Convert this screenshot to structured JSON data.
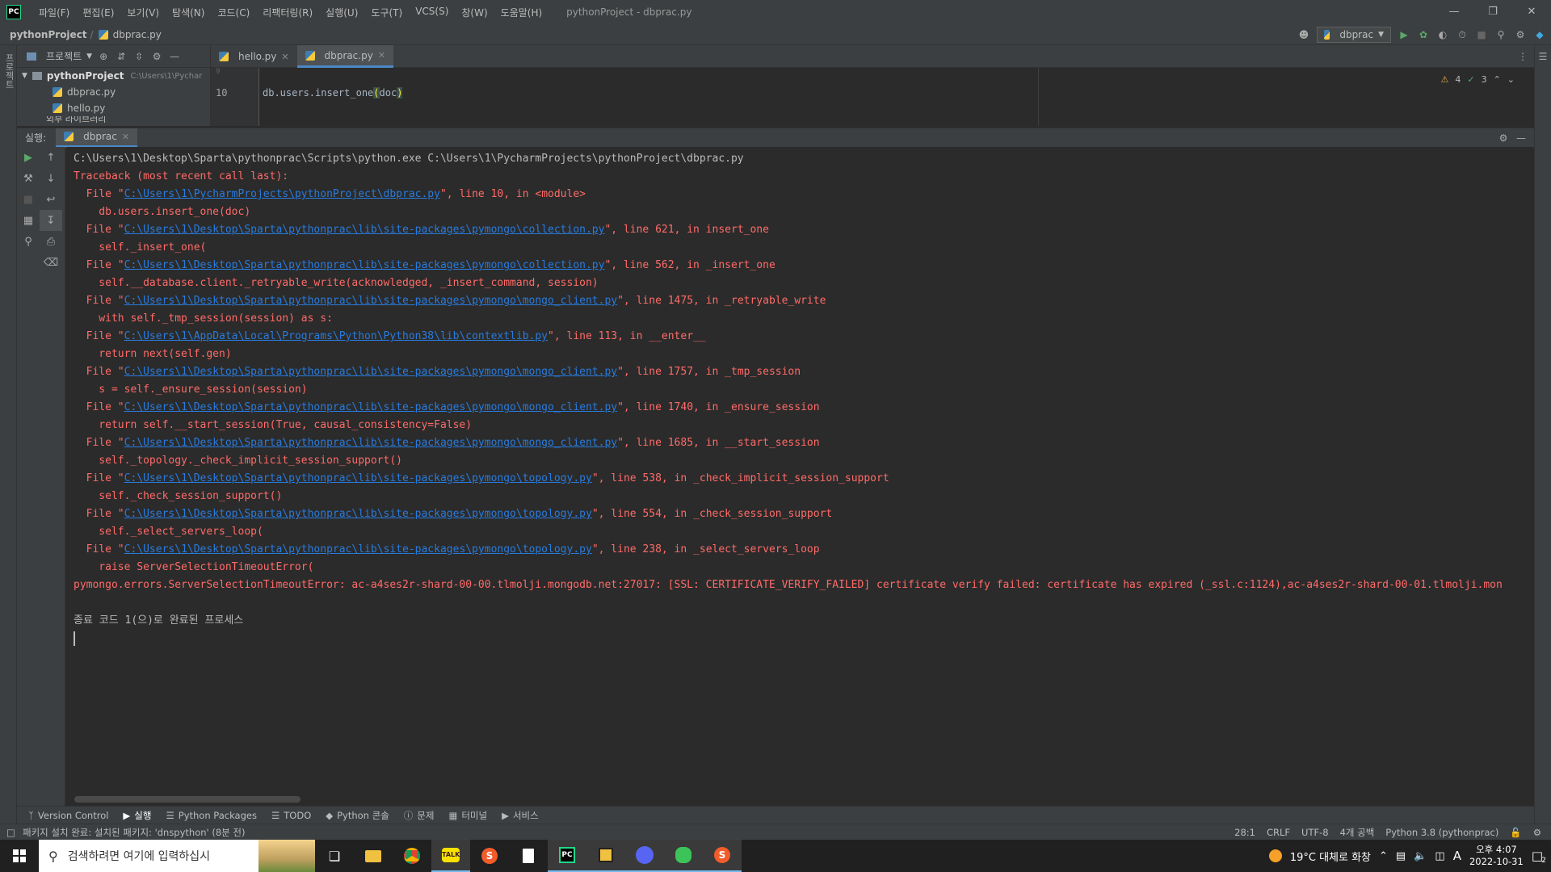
{
  "titlebar": {
    "menu": [
      "파일(F)",
      "편집(E)",
      "보기(V)",
      "탐색(N)",
      "코드(C)",
      "리팩터링(R)",
      "실행(U)",
      "도구(T)",
      "VCS(S)",
      "창(W)",
      "도움말(H)"
    ],
    "window_title": "pythonProject - dbprac.py"
  },
  "navbar": {
    "project": "pythonProject",
    "file": "dbprac.py"
  },
  "toolbar": {
    "run_config": "dbprac"
  },
  "project_panel": {
    "title": "프로젝트",
    "root": "pythonProject",
    "root_path": "C:\\Users\\1\\Pychar",
    "files": [
      "dbprac.py",
      "hello.py"
    ],
    "partial": "외부 라이브러리"
  },
  "editor": {
    "tabs": [
      {
        "label": "hello.py",
        "active": false
      },
      {
        "label": "dbprac.py",
        "active": true
      }
    ],
    "line_numbers": [
      "9",
      "10"
    ],
    "code": {
      "pre": "db.users.insert_one",
      "open": "(",
      "arg": "doc",
      "close": ")"
    },
    "warnings": "4",
    "checks": "3"
  },
  "run": {
    "label": "실행:",
    "tab": "dbprac",
    "console": [
      {
        "type": "cmd",
        "text": "C:\\Users\\1\\Desktop\\Sparta\\pythonprac\\Scripts\\python.exe C:\\Users\\1\\PycharmProjects\\pythonProject\\dbprac.py"
      },
      {
        "type": "err",
        "text": "Traceback (most recent call last):"
      },
      {
        "type": "file",
        "path": "C:\\Users\\1\\PycharmProjects\\pythonProject\\dbprac.py",
        "rest": "\", line 10, in <module>"
      },
      {
        "type": "err",
        "text": "    db.users.insert_one(doc)"
      },
      {
        "type": "file",
        "path": "C:\\Users\\1\\Desktop\\Sparta\\pythonprac\\lib\\site-packages\\pymongo\\collection.py",
        "rest": "\", line 621, in insert_one"
      },
      {
        "type": "err",
        "text": "    self._insert_one("
      },
      {
        "type": "file",
        "path": "C:\\Users\\1\\Desktop\\Sparta\\pythonprac\\lib\\site-packages\\pymongo\\collection.py",
        "rest": "\", line 562, in _insert_one"
      },
      {
        "type": "err",
        "text": "    self.__database.client._retryable_write(acknowledged, _insert_command, session)"
      },
      {
        "type": "file",
        "path": "C:\\Users\\1\\Desktop\\Sparta\\pythonprac\\lib\\site-packages\\pymongo\\mongo_client.py",
        "rest": "\", line 1475, in _retryable_write"
      },
      {
        "type": "err",
        "text": "    with self._tmp_session(session) as s:"
      },
      {
        "type": "file",
        "path": "C:\\Users\\1\\AppData\\Local\\Programs\\Python\\Python38\\lib\\contextlib.py",
        "rest": "\", line 113, in __enter__"
      },
      {
        "type": "err",
        "text": "    return next(self.gen)"
      },
      {
        "type": "file",
        "path": "C:\\Users\\1\\Desktop\\Sparta\\pythonprac\\lib\\site-packages\\pymongo\\mongo_client.py",
        "rest": "\", line 1757, in _tmp_session"
      },
      {
        "type": "err",
        "text": "    s = self._ensure_session(session)"
      },
      {
        "type": "file",
        "path": "C:\\Users\\1\\Desktop\\Sparta\\pythonprac\\lib\\site-packages\\pymongo\\mongo_client.py",
        "rest": "\", line 1740, in _ensure_session"
      },
      {
        "type": "err",
        "text": "    return self.__start_session(True, causal_consistency=False)"
      },
      {
        "type": "file",
        "path": "C:\\Users\\1\\Desktop\\Sparta\\pythonprac\\lib\\site-packages\\pymongo\\mongo_client.py",
        "rest": "\", line 1685, in __start_session"
      },
      {
        "type": "err",
        "text": "    self._topology._check_implicit_session_support()"
      },
      {
        "type": "file",
        "path": "C:\\Users\\1\\Desktop\\Sparta\\pythonprac\\lib\\site-packages\\pymongo\\topology.py",
        "rest": "\", line 538, in _check_implicit_session_support"
      },
      {
        "type": "err",
        "text": "    self._check_session_support()"
      },
      {
        "type": "file",
        "path": "C:\\Users\\1\\Desktop\\Sparta\\pythonprac\\lib\\site-packages\\pymongo\\topology.py",
        "rest": "\", line 554, in _check_session_support"
      },
      {
        "type": "err",
        "text": "    self._select_servers_loop("
      },
      {
        "type": "file",
        "path": "C:\\Users\\1\\Desktop\\Sparta\\pythonprac\\lib\\site-packages\\pymongo\\topology.py",
        "rest": "\", line 238, in _select_servers_loop"
      },
      {
        "type": "err",
        "text": "    raise ServerSelectionTimeoutError("
      },
      {
        "type": "err",
        "text": "pymongo.errors.ServerSelectionTimeoutError: ac-a4ses2r-shard-00-00.tlmolji.mongodb.net:27017: [SSL: CERTIFICATE_VERIFY_FAILED] certificate verify failed: certificate has expired (_ssl.c:1124),ac-a4ses2r-shard-00-01.tlmolji.mon"
      },
      {
        "type": "blank",
        "text": ""
      },
      {
        "type": "done",
        "text": "종료 코드 1(으)로 완료된 프로세스"
      }
    ]
  },
  "bottom_tabs": [
    "Version Control",
    "실행",
    "Python Packages",
    "TODO",
    "Python 콘솔",
    "문제",
    "터미널",
    "서비스"
  ],
  "statusbar": {
    "message": "패키지 설치 완료: 설치된 패키지: 'dnspython' (8분 전)",
    "position": "28:1",
    "line_sep": "CRLF",
    "encoding": "UTF-8",
    "indent": "4개 공백",
    "interpreter": "Python 3.8 (pythonprac)"
  },
  "taskbar": {
    "search_placeholder": "검색하려면 여기에 입력하십시",
    "weather": "19°C 대체로 화창",
    "ime": "A",
    "time": "오후 4:07",
    "date": "2022-10-31",
    "notifications": "2"
  },
  "colors": {
    "error": "#ff6b68",
    "link": "#287bde",
    "accent": "#4a88c7"
  }
}
